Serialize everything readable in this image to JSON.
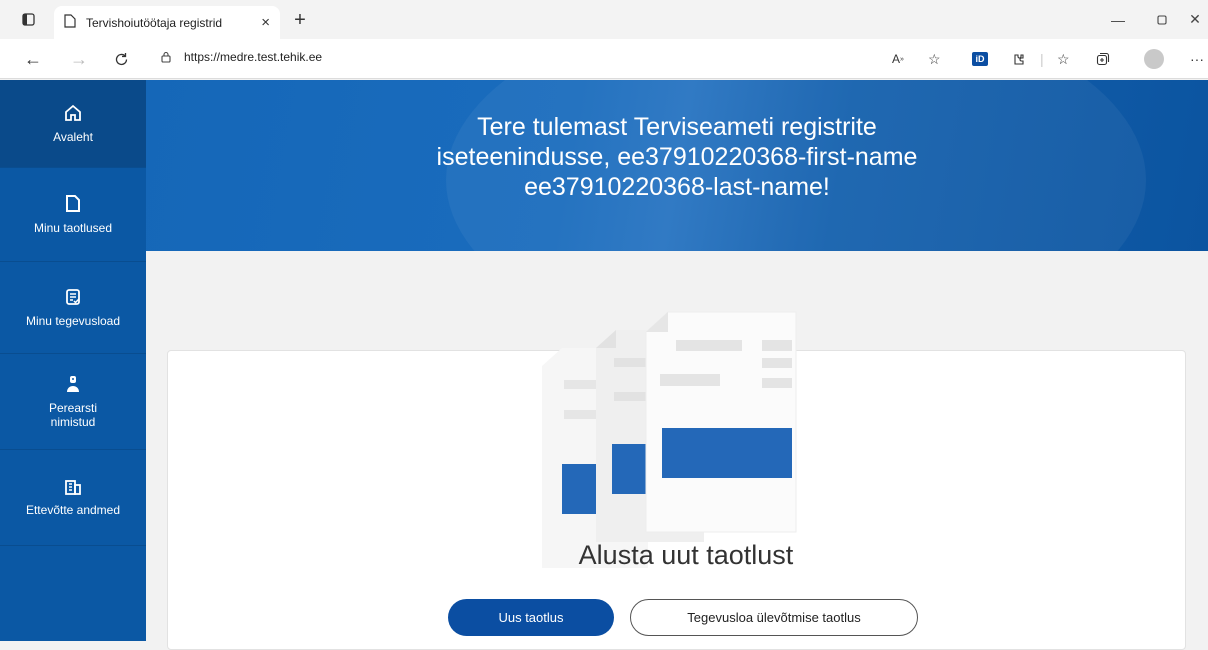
{
  "browser": {
    "tab_title": "Tervishoiutöötaja registrid",
    "url": "https://medre.test.tehik.ee",
    "id_badge": "iD"
  },
  "sidebar": {
    "items": [
      {
        "label": "Avaleht",
        "icon": "home-icon",
        "active": true
      },
      {
        "label": "Minu taotlused",
        "icon": "document-icon",
        "active": false
      },
      {
        "label": "Minu tegevusload",
        "icon": "license-icon",
        "active": false
      },
      {
        "label": "Perearsti nimistud",
        "icon": "doctor-icon",
        "active": false
      },
      {
        "label": "Ettevõtte andmed",
        "icon": "building-icon",
        "active": false
      }
    ]
  },
  "hero": {
    "line1": "Tere tulemast Terviseameti registrite",
    "line2": "iseteenindusse, ee37910220368-first-name",
    "line3": "ee37910220368-last-name!"
  },
  "main": {
    "title": "Alusta uut taotlust",
    "primary_button": "Uus taotlus",
    "secondary_button": "Tegevusloa ülevõtmise taotlus"
  },
  "colors": {
    "brand_blue": "#0b58a4",
    "button_blue": "#0b4ea2"
  }
}
